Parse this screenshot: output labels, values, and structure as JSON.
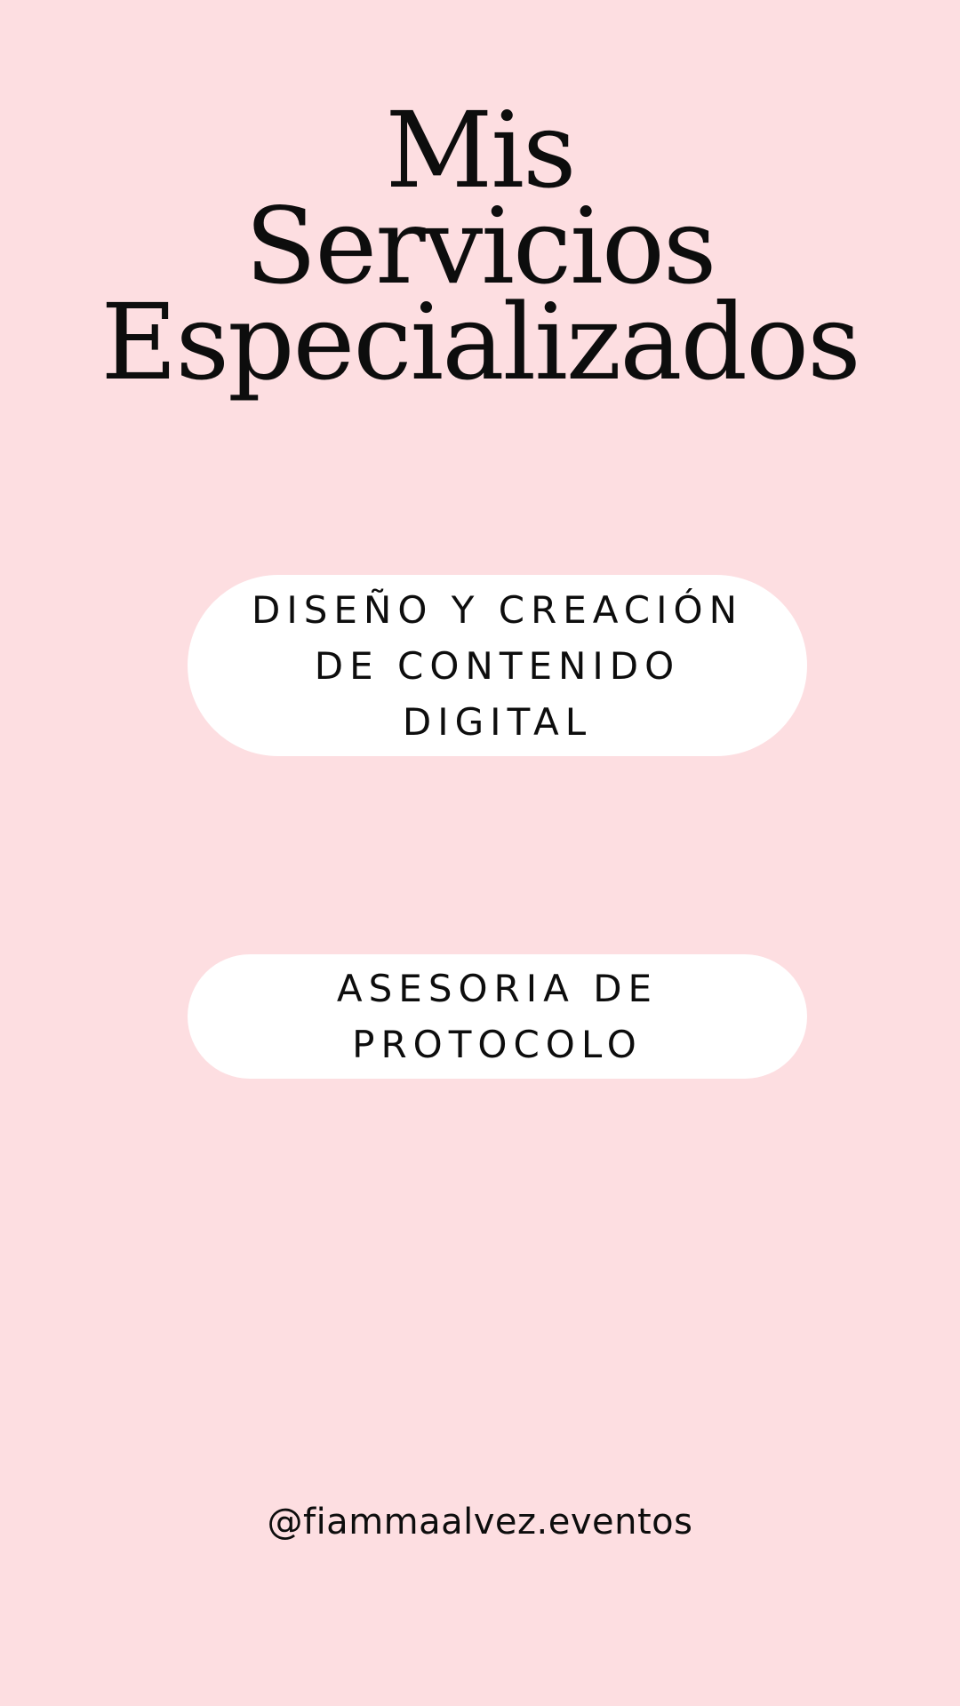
{
  "title": {
    "line1": "Mis",
    "line2": "Servicios",
    "line3": "Especializados"
  },
  "services": [
    {
      "line1": "DISEÑO Y CREACIÓN",
      "line2": "DE CONTENIDO",
      "line3": "DIGITAL"
    },
    {
      "line1": "ASESORIA DE",
      "line2": "PROTOCOLO"
    }
  ],
  "footer": {
    "handle": "@fiammaalvez.eventos"
  },
  "colors": {
    "background": "#fddee1",
    "pill": "#ffffff",
    "text": "#0d0d0d"
  }
}
